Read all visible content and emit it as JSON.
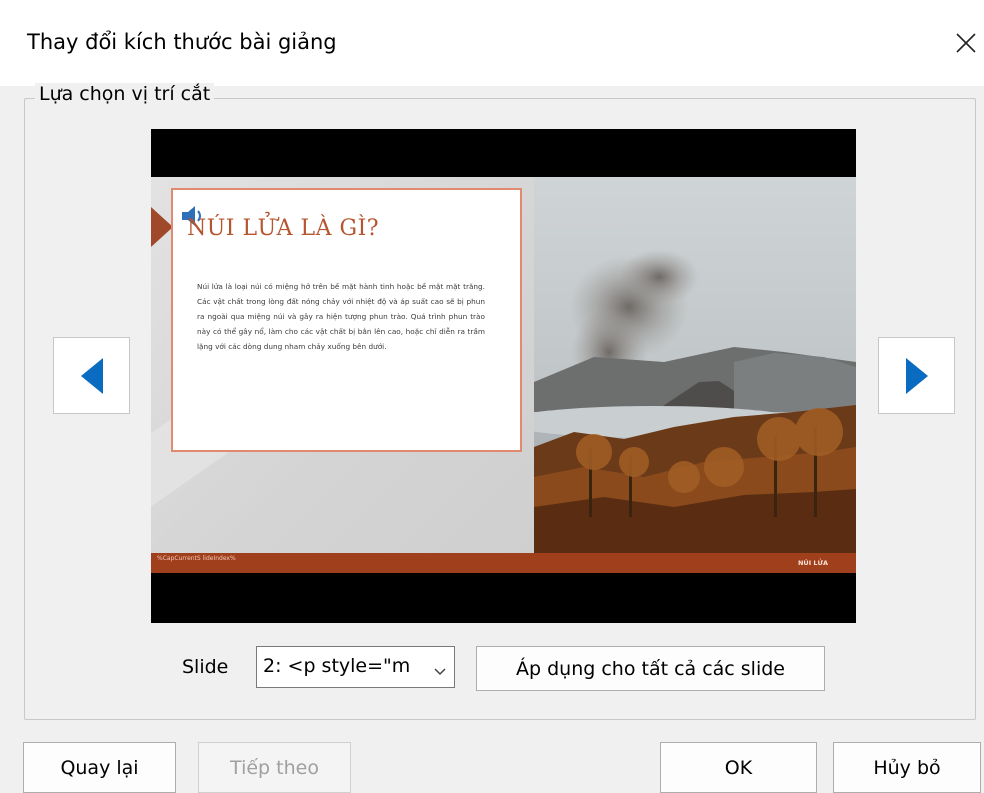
{
  "dialog": {
    "title": "Thay đổi kích thước bài giảng",
    "close_icon": "close-icon",
    "group_label": "Lựa chọn vị trí cắt"
  },
  "preview": {
    "prev_icon": "triangle-left-icon",
    "next_icon": "triangle-right-icon",
    "accent_color": "#0070c0",
    "slide": {
      "heading": "NÚI LỬA LÀ GÌ?",
      "speaker_icon": "speaker-icon",
      "body": "Núi lửa là loại núi có miệng hở trên bề mặt hành tinh hoặc bề mặt mặt trăng. Các vật chất trong lòng đất nóng chảy với nhiệt độ và áp suất cao sẽ bị phun ra ngoài qua miệng núi và gây ra hiện tượng phun trào. Quá trình phun trào này có thể gây nổ, làm cho các vật chất bị bắn lên cao, hoặc chỉ diễn ra trầm lặng với các dòng dung nham chảy xuống bên dưới.",
      "footer_left": "%CapCurrentS lideIndex%",
      "footer_right": "NÚI LỬA",
      "heading_color": "#b5542e",
      "footer_color": "#a03f1c"
    }
  },
  "controls": {
    "slide_label": "Slide",
    "slide_select_value": "2: <p style=\"m",
    "apply_all_button": "Áp dụng cho tất cả các slide"
  },
  "footer": {
    "back_button": "Quay lại",
    "next_button": "Tiếp theo",
    "ok_button": "OK",
    "cancel_button": "Hủy bỏ"
  }
}
